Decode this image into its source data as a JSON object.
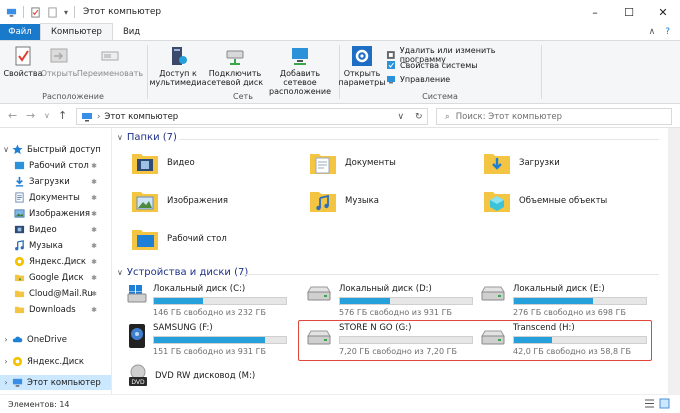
{
  "window": {
    "title": "Этот компьютер"
  },
  "ribbon_tabs": {
    "file": "Файл",
    "computer": "Компьютер",
    "view": "Вид"
  },
  "ribbon": {
    "location": {
      "label": "Расположение",
      "properties": "Свойства",
      "open": "Открыть",
      "rename": "Переименовать"
    },
    "network": {
      "label": "Сеть",
      "media_access": "Доступ к мультимедиа",
      "map_drive": "Подключить сетевой диск",
      "add_location": "Добавить сетевое расположение"
    },
    "system": {
      "label": "Система",
      "open_settings": "Открыть параметры",
      "uninstall": "Удалить или изменить программу",
      "sys_props": "Свойства системы",
      "manage": "Управление"
    }
  },
  "address": {
    "path": "Этот компьютер",
    "search_placeholder": "Поиск: Этот компьютер"
  },
  "sidebar": {
    "items": [
      {
        "label": "Быстрый доступ",
        "level": 0
      },
      {
        "label": "Рабочий стол",
        "level": 1
      },
      {
        "label": "Загрузки",
        "level": 1
      },
      {
        "label": "Документы",
        "level": 1
      },
      {
        "label": "Изображения",
        "level": 1
      },
      {
        "label": "Видео",
        "level": 1
      },
      {
        "label": "Музыка",
        "level": 1
      },
      {
        "label": "Яндекс.Диск",
        "level": 1
      },
      {
        "label": "Google Диск",
        "level": 1
      },
      {
        "label": "Cloud@Mail.Ru",
        "level": 1
      },
      {
        "label": "Downloads",
        "level": 1
      },
      {
        "label": "OneDrive",
        "level": 0
      },
      {
        "label": "Яндекс.Диск",
        "level": 0
      },
      {
        "label": "Этот компьютер",
        "level": 0
      }
    ]
  },
  "folders_section": {
    "title": "Папки (7)",
    "items": [
      "Видео",
      "Документы",
      "Загрузки",
      "Изображения",
      "Музыка",
      "Объемные объекты",
      "Рабочий стол"
    ]
  },
  "drives_section": {
    "title": "Устройства и диски (7)",
    "items": [
      {
        "name": "Локальный диск (C:)",
        "free": "146 ГБ свободно из 232 ГБ",
        "used_fraction": 0.37
      },
      {
        "name": "Локальный диск (D:)",
        "free": "576 ГБ свободно из 931 ГБ",
        "used_fraction": 0.38
      },
      {
        "name": "Локальный диск (E:)",
        "free": "276 ГБ свободно из 698 ГБ",
        "used_fraction": 0.6
      },
      {
        "name": "SAMSUNG (F:)",
        "free": "151 ГБ свободно из 931 ГБ",
        "used_fraction": 0.84
      },
      {
        "name": "STORE N GO (G:)",
        "free": "7,20 ГБ свободно из 7,20 ГБ",
        "used_fraction": 0.0
      },
      {
        "name": "Transcend (H:)",
        "free": "42,0 ГБ свободно из 58,8 ГБ",
        "used_fraction": 0.29
      },
      {
        "name": "DVD RW дисковод (M:)",
        "free": "",
        "used_fraction": null
      }
    ]
  },
  "status": {
    "count": "Элементов: 14"
  },
  "colors": {
    "accent": "#1979ca",
    "bar": "#26a0da",
    "highlight": "#e2463b",
    "section_title": "#1e3287"
  }
}
